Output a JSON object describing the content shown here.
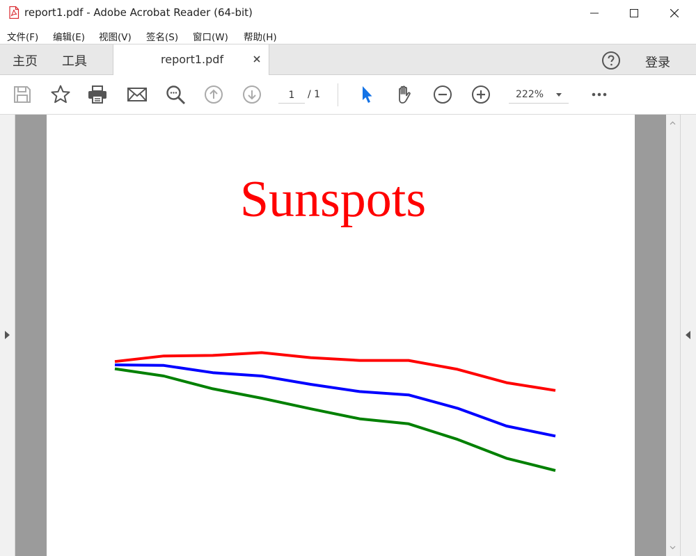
{
  "window": {
    "title": "report1.pdf - Adobe Acrobat Reader (64-bit)",
    "icon": "pdf-file-icon",
    "controls": [
      "minimize-icon",
      "maximize-icon",
      "close-icon"
    ]
  },
  "menu": {
    "items": [
      {
        "label": "文件(F)"
      },
      {
        "label": "编辑(E)"
      },
      {
        "label": "视图(V)"
      },
      {
        "label": "签名(S)"
      },
      {
        "label": "窗口(W)"
      },
      {
        "label": "帮助(H)"
      }
    ]
  },
  "tabs": {
    "home": "主页",
    "tools": "工具",
    "document": "report1.pdf",
    "login": "登录",
    "help_icon": "help-circle-icon"
  },
  "toolbar": {
    "icons": [
      "save-icon",
      "star-icon",
      "print-icon",
      "mail-icon",
      "search-icon",
      "previous-page-icon",
      "next-page-icon",
      "select-cursor-icon",
      "hand-tool-icon",
      "zoom-out-icon",
      "zoom-in-icon",
      "more-icon"
    ],
    "page_current": "1",
    "page_total": "/ 1",
    "zoom": "222%",
    "accent_color": "#1473e6"
  },
  "document": {
    "title": "Sunspots",
    "title_color": "#ff0000"
  },
  "chart_data": {
    "type": "line",
    "title": "Sunspots",
    "xlabel": "",
    "ylabel": "",
    "x": [
      0,
      1,
      2,
      3,
      4,
      5,
      6,
      7,
      8,
      9
    ],
    "ylim": [
      0,
      100
    ],
    "grid": false,
    "axes_visible": false,
    "series": [
      {
        "color": "#ff0000",
        "values": [
          78,
          83,
          83.5,
          86,
          81.5,
          79,
          79,
          71,
          59,
          52
        ]
      },
      {
        "color": "#0000ff",
        "values": [
          75,
          74.5,
          68,
          65,
          57.5,
          51,
          48,
          36,
          20,
          11
        ]
      },
      {
        "color": "#008000",
        "values": [
          71.5,
          65,
          53.5,
          45,
          35.5,
          26.5,
          22,
          8,
          -9,
          -20
        ]
      }
    ]
  }
}
